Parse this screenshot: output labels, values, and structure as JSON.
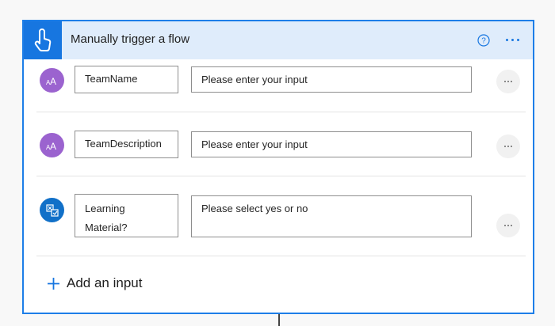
{
  "trigger": {
    "title": "Manually trigger a flow",
    "icons": {
      "main": "hand-touch-icon",
      "help": "help-circle-icon",
      "more": "more-options-icon"
    },
    "accent": "#1776e0"
  },
  "inputs": [
    {
      "name": "TeamName",
      "placeholder": "Please enter your input",
      "type_icon": "text-type-icon",
      "icon_color": "#9b63cf"
    },
    {
      "name": "TeamDescription",
      "placeholder": "Please enter your input",
      "type_icon": "text-type-icon",
      "icon_color": "#9b63cf"
    },
    {
      "name_line1": "Learning",
      "name_line2": "Material?",
      "placeholder": "Please select yes or no",
      "type_icon": "yes-no-type-icon",
      "icon_color": "#1170c8"
    }
  ],
  "add_input": {
    "label": "Add an input",
    "icon": "plus-icon"
  }
}
